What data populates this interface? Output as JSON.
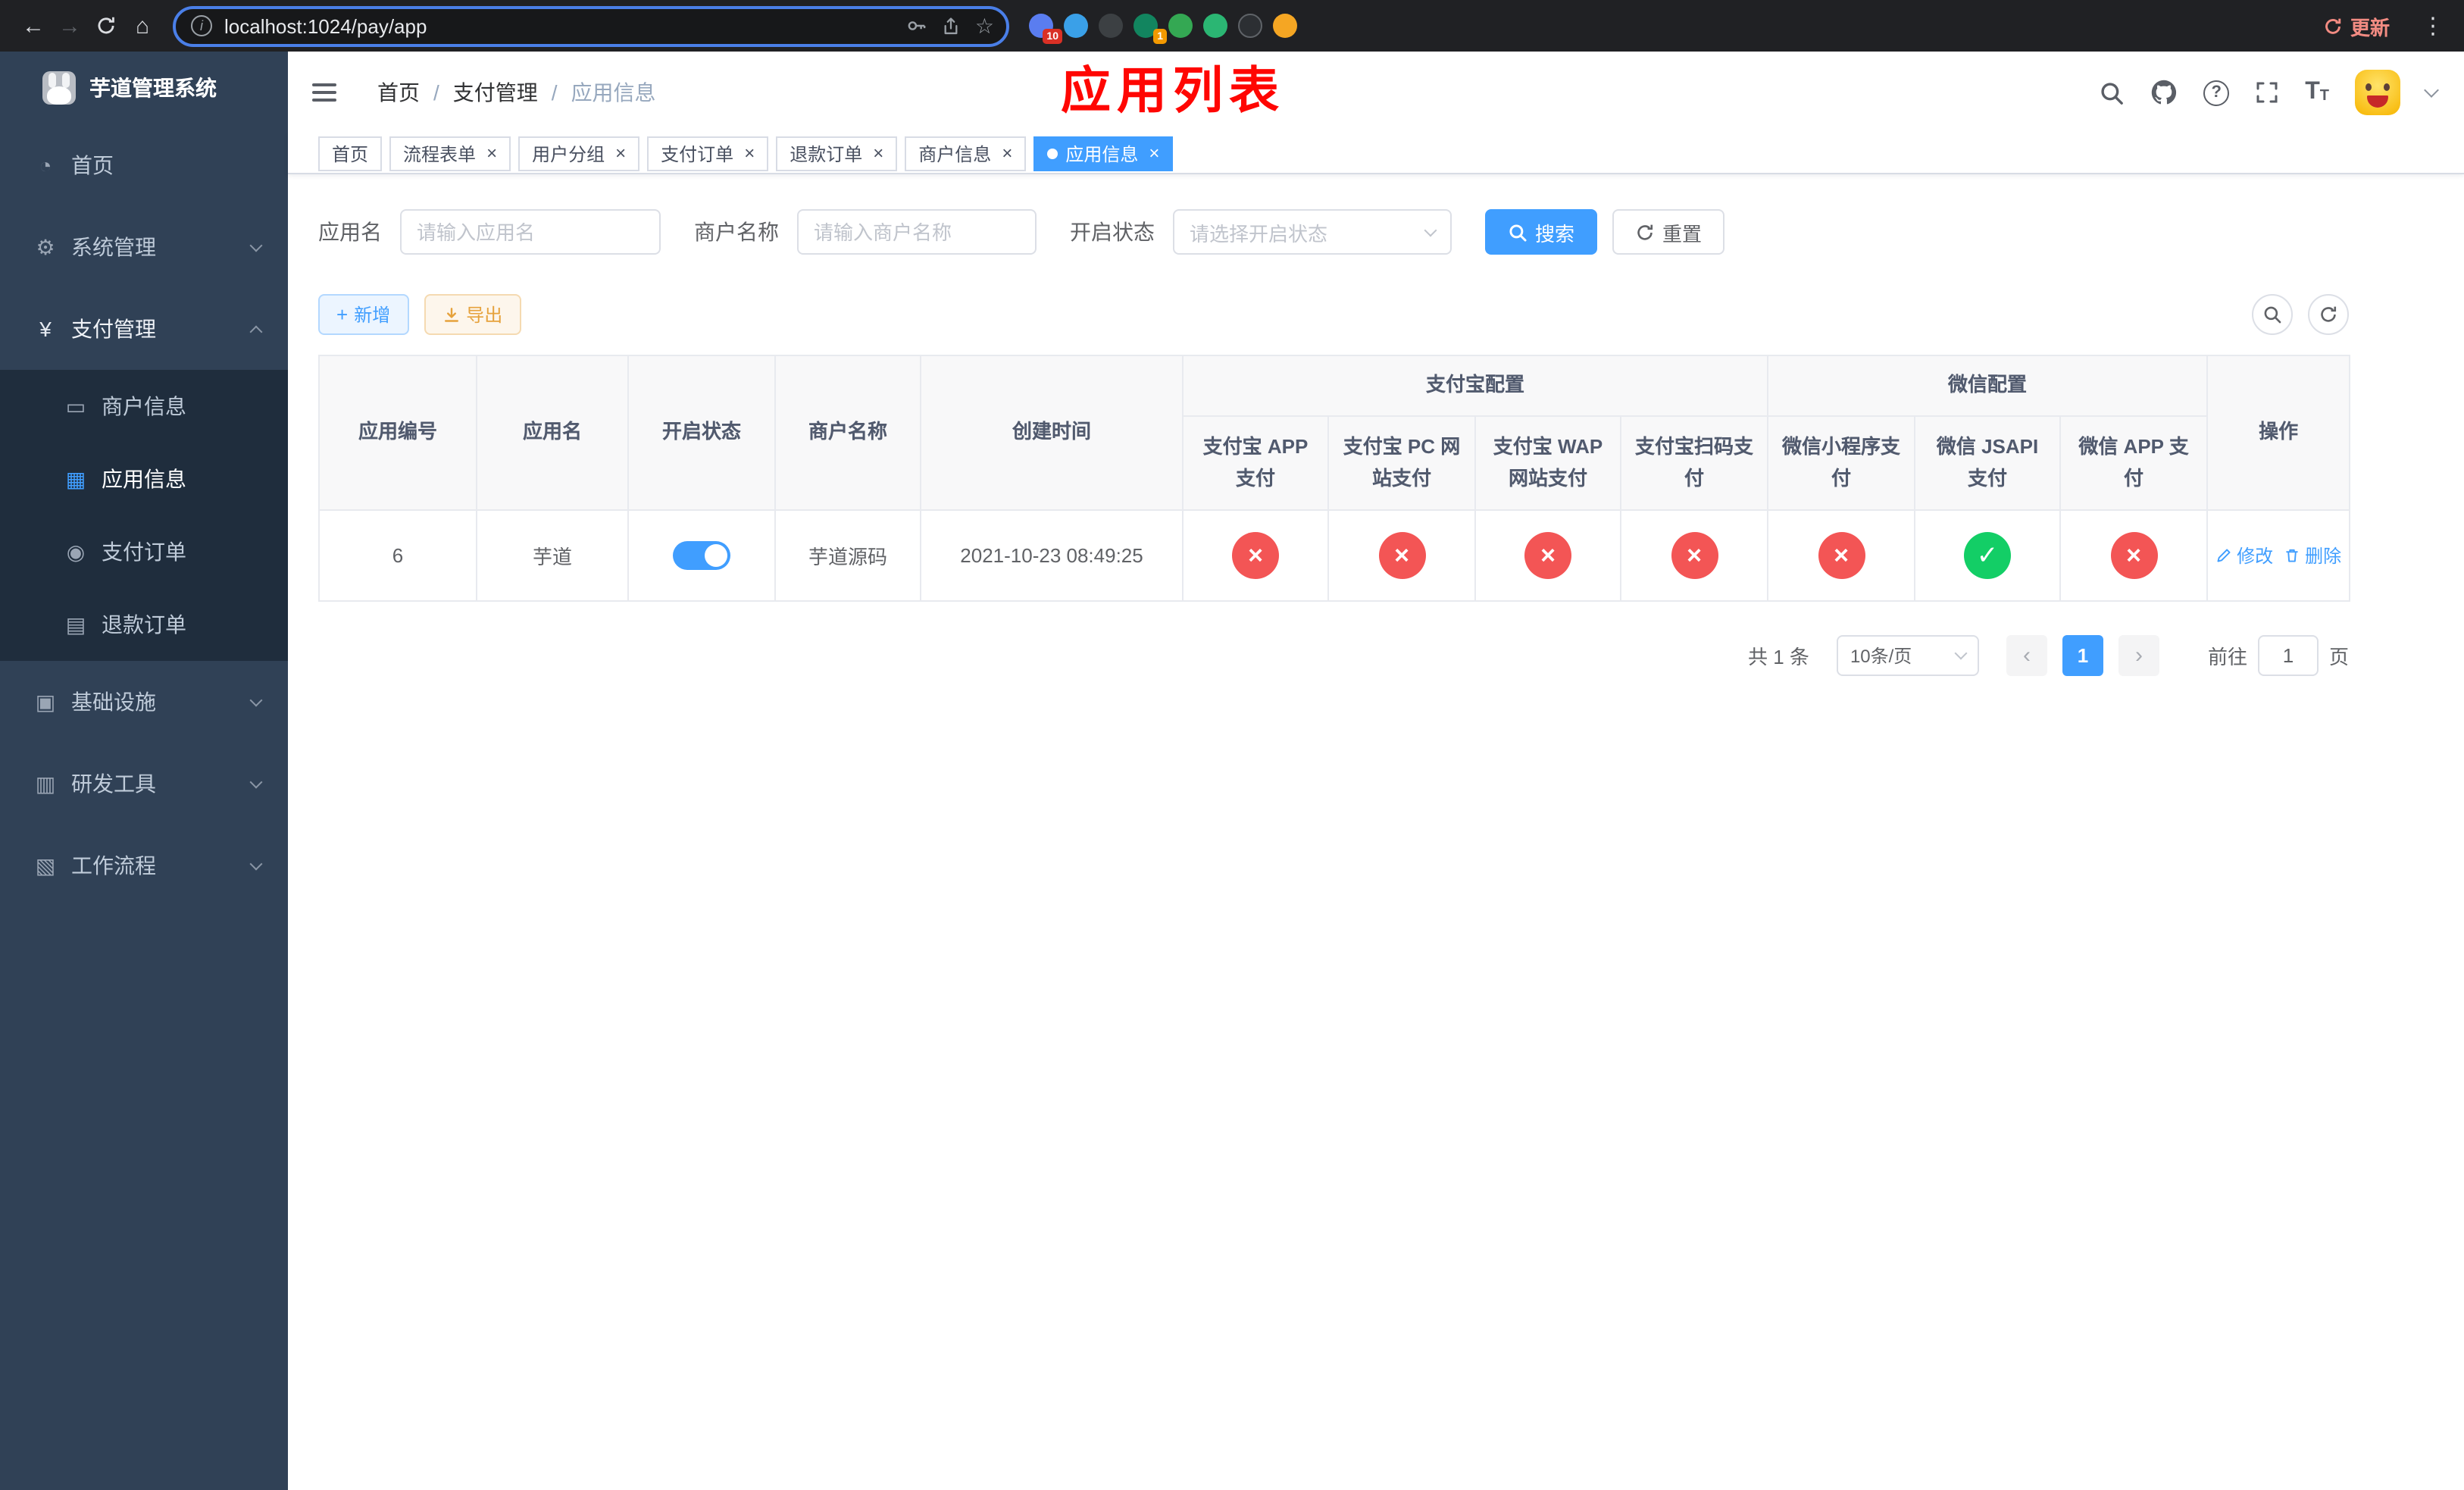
{
  "browser": {
    "url": "localhost:1024/pay/app",
    "update_label": "更新",
    "ext_badge_first": "10",
    "ext_badge_fourth": "1"
  },
  "icons": {
    "back": "←",
    "forward": "→",
    "home": "⌂",
    "info": "i",
    "star": "☆",
    "kebab": "⋮",
    "dashboard": "◔",
    "gear": "⚙",
    "yen": "¥",
    "card": "▭",
    "grid": "▦",
    "order": "◉",
    "doc": "▤",
    "infra": "▣",
    "tools": "▥",
    "flow": "▧",
    "question": "?",
    "font_size": "T",
    "check": "✓",
    "cross": "×",
    "close": "×",
    "plus": "+",
    "prev": "‹",
    "next": "›"
  },
  "sidebar": {
    "title": "芋道管理系统",
    "menu": {
      "home": "首页",
      "system": "系统管理",
      "pay": "支付管理",
      "pay_children": {
        "merchant": "商户信息",
        "app": "应用信息",
        "order": "支付订单",
        "refund": "退款订单"
      },
      "infra": "基础设施",
      "dev": "研发工具",
      "flow": "工作流程"
    }
  },
  "header": {
    "breadcrumb": [
      "首页",
      "支付管理",
      "应用信息"
    ],
    "separator": "/",
    "annotation": "应用列表"
  },
  "tabs": [
    {
      "label": "首页"
    },
    {
      "label": "流程表单"
    },
    {
      "label": "用户分组"
    },
    {
      "label": "支付订单"
    },
    {
      "label": "退款订单"
    },
    {
      "label": "商户信息"
    },
    {
      "label": "应用信息"
    }
  ],
  "filters": {
    "app_name_label": "应用名",
    "app_name_placeholder": "请输入应用名",
    "merchant_label": "商户名称",
    "merchant_placeholder": "请输入商户名称",
    "status_label": "开启状态",
    "status_placeholder": "请选择开启状态",
    "search_label": "搜索",
    "reset_label": "重置"
  },
  "toolbar": {
    "add_label": "新增",
    "export_label": "导出"
  },
  "table": {
    "col_id": "应用编号",
    "col_name": "应用名",
    "col_status": "开启状态",
    "col_merchant": "商户名称",
    "col_created": "创建时间",
    "group_alipay": "支付宝配置",
    "group_wechat": "微信配置",
    "col_alipay_app": "支付宝 APP 支付",
    "col_alipay_pc": "支付宝 PC 网站支付",
    "col_alipay_wap": "支付宝 WAP 网站支付",
    "col_alipay_qr": "支付宝扫码支付",
    "col_wx_mini": "微信小程序支付",
    "col_wx_jsapi": "微信 JSAPI 支付",
    "col_wx_app": "微信 APP 支付",
    "col_actions": "操作",
    "row": {
      "id": "6",
      "name": "芋道",
      "enabled": true,
      "merchant": "芋道源码",
      "created": "2021-10-23 08:49:25",
      "channels": [
        false,
        false,
        false,
        false,
        false,
        true,
        false
      ],
      "edit_label": "修改",
      "delete_label": "删除"
    }
  },
  "pagination": {
    "total_label": "共 1 条",
    "page_size": "10条/页",
    "current_page": "1",
    "goto_label": "前往",
    "goto_value": "1",
    "unit_label": "页"
  },
  "colors": {
    "primary": "#409eff",
    "success": "#13ce66",
    "danger": "#f35555",
    "annotation": "#ff0602"
  }
}
